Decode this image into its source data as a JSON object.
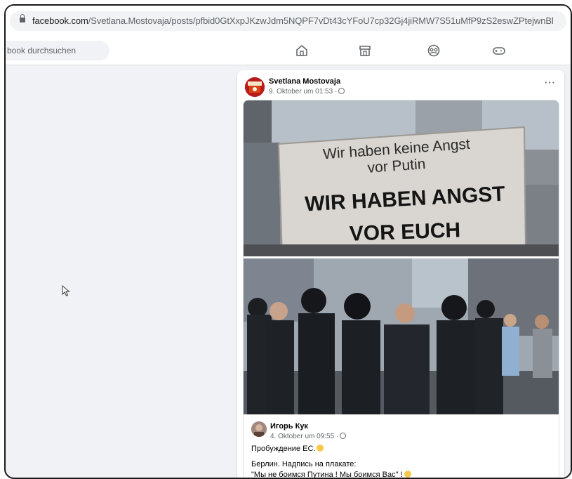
{
  "browser": {
    "url_host": "facebook.com",
    "url_path": "/Svetlana.Mostovaja/posts/pfbid0GtXxpJKzwJdm5NQPF7vDt43cYFoU7cp32Gj4jiRMW7S51uMfP9zS2eswZPtejwnBl"
  },
  "topbar": {
    "search_text": "book durchsuchen",
    "nav_icons": [
      "home-icon",
      "marketplace-icon",
      "groups-icon",
      "gaming-icon"
    ]
  },
  "post": {
    "author": "Svetlana Mostovaja",
    "timestamp": "9. Oktober um 01:53 ·",
    "more": "···",
    "image1_sign": {
      "line1": "Wir haben keine Angst",
      "line2": "vor Putin",
      "line3": "WIR HABEN ANGST",
      "line4": "VOR EUCH"
    },
    "shared": {
      "author": "Игорь Кук",
      "timestamp": "4. Oktober um 09:55 ·",
      "text_line1": "Пробуждение ЕС.",
      "text_line2": "Берлин. Надпись на плакате:",
      "text_line3": "\"Мы не боимся Путина ! Мы боимся Вас\" !"
    }
  },
  "colors": {
    "background": "#f0f2f5",
    "card": "#ffffff",
    "secondary_text": "#65676b"
  }
}
